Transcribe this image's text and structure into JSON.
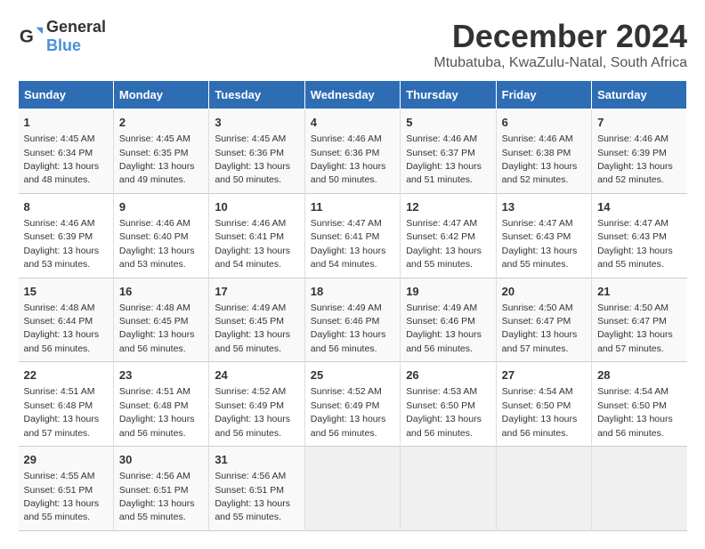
{
  "logo": {
    "general": "General",
    "blue": "Blue"
  },
  "title": "December 2024",
  "subtitle": "Mtubatuba, KwaZulu-Natal, South Africa",
  "days_of_week": [
    "Sunday",
    "Monday",
    "Tuesday",
    "Wednesday",
    "Thursday",
    "Friday",
    "Saturday"
  ],
  "weeks": [
    [
      {
        "day": "1",
        "sunrise": "4:45 AM",
        "sunset": "6:34 PM",
        "daylight": "13 hours and 48 minutes."
      },
      {
        "day": "2",
        "sunrise": "4:45 AM",
        "sunset": "6:35 PM",
        "daylight": "13 hours and 49 minutes."
      },
      {
        "day": "3",
        "sunrise": "4:45 AM",
        "sunset": "6:36 PM",
        "daylight": "13 hours and 50 minutes."
      },
      {
        "day": "4",
        "sunrise": "4:46 AM",
        "sunset": "6:36 PM",
        "daylight": "13 hours and 50 minutes."
      },
      {
        "day": "5",
        "sunrise": "4:46 AM",
        "sunset": "6:37 PM",
        "daylight": "13 hours and 51 minutes."
      },
      {
        "day": "6",
        "sunrise": "4:46 AM",
        "sunset": "6:38 PM",
        "daylight": "13 hours and 52 minutes."
      },
      {
        "day": "7",
        "sunrise": "4:46 AM",
        "sunset": "6:39 PM",
        "daylight": "13 hours and 52 minutes."
      }
    ],
    [
      {
        "day": "8",
        "sunrise": "4:46 AM",
        "sunset": "6:39 PM",
        "daylight": "13 hours and 53 minutes."
      },
      {
        "day": "9",
        "sunrise": "4:46 AM",
        "sunset": "6:40 PM",
        "daylight": "13 hours and 53 minutes."
      },
      {
        "day": "10",
        "sunrise": "4:46 AM",
        "sunset": "6:41 PM",
        "daylight": "13 hours and 54 minutes."
      },
      {
        "day": "11",
        "sunrise": "4:47 AM",
        "sunset": "6:41 PM",
        "daylight": "13 hours and 54 minutes."
      },
      {
        "day": "12",
        "sunrise": "4:47 AM",
        "sunset": "6:42 PM",
        "daylight": "13 hours and 55 minutes."
      },
      {
        "day": "13",
        "sunrise": "4:47 AM",
        "sunset": "6:43 PM",
        "daylight": "13 hours and 55 minutes."
      },
      {
        "day": "14",
        "sunrise": "4:47 AM",
        "sunset": "6:43 PM",
        "daylight": "13 hours and 55 minutes."
      }
    ],
    [
      {
        "day": "15",
        "sunrise": "4:48 AM",
        "sunset": "6:44 PM",
        "daylight": "13 hours and 56 minutes."
      },
      {
        "day": "16",
        "sunrise": "4:48 AM",
        "sunset": "6:45 PM",
        "daylight": "13 hours and 56 minutes."
      },
      {
        "day": "17",
        "sunrise": "4:49 AM",
        "sunset": "6:45 PM",
        "daylight": "13 hours and 56 minutes."
      },
      {
        "day": "18",
        "sunrise": "4:49 AM",
        "sunset": "6:46 PM",
        "daylight": "13 hours and 56 minutes."
      },
      {
        "day": "19",
        "sunrise": "4:49 AM",
        "sunset": "6:46 PM",
        "daylight": "13 hours and 56 minutes."
      },
      {
        "day": "20",
        "sunrise": "4:50 AM",
        "sunset": "6:47 PM",
        "daylight": "13 hours and 57 minutes."
      },
      {
        "day": "21",
        "sunrise": "4:50 AM",
        "sunset": "6:47 PM",
        "daylight": "13 hours and 57 minutes."
      }
    ],
    [
      {
        "day": "22",
        "sunrise": "4:51 AM",
        "sunset": "6:48 PM",
        "daylight": "13 hours and 57 minutes."
      },
      {
        "day": "23",
        "sunrise": "4:51 AM",
        "sunset": "6:48 PM",
        "daylight": "13 hours and 56 minutes."
      },
      {
        "day": "24",
        "sunrise": "4:52 AM",
        "sunset": "6:49 PM",
        "daylight": "13 hours and 56 minutes."
      },
      {
        "day": "25",
        "sunrise": "4:52 AM",
        "sunset": "6:49 PM",
        "daylight": "13 hours and 56 minutes."
      },
      {
        "day": "26",
        "sunrise": "4:53 AM",
        "sunset": "6:50 PM",
        "daylight": "13 hours and 56 minutes."
      },
      {
        "day": "27",
        "sunrise": "4:54 AM",
        "sunset": "6:50 PM",
        "daylight": "13 hours and 56 minutes."
      },
      {
        "day": "28",
        "sunrise": "4:54 AM",
        "sunset": "6:50 PM",
        "daylight": "13 hours and 56 minutes."
      }
    ],
    [
      {
        "day": "29",
        "sunrise": "4:55 AM",
        "sunset": "6:51 PM",
        "daylight": "13 hours and 55 minutes."
      },
      {
        "day": "30",
        "sunrise": "4:56 AM",
        "sunset": "6:51 PM",
        "daylight": "13 hours and 55 minutes."
      },
      {
        "day": "31",
        "sunrise": "4:56 AM",
        "sunset": "6:51 PM",
        "daylight": "13 hours and 55 minutes."
      },
      null,
      null,
      null,
      null
    ]
  ],
  "labels": {
    "sunrise": "Sunrise:",
    "sunset": "Sunset:",
    "daylight": "Daylight:"
  }
}
